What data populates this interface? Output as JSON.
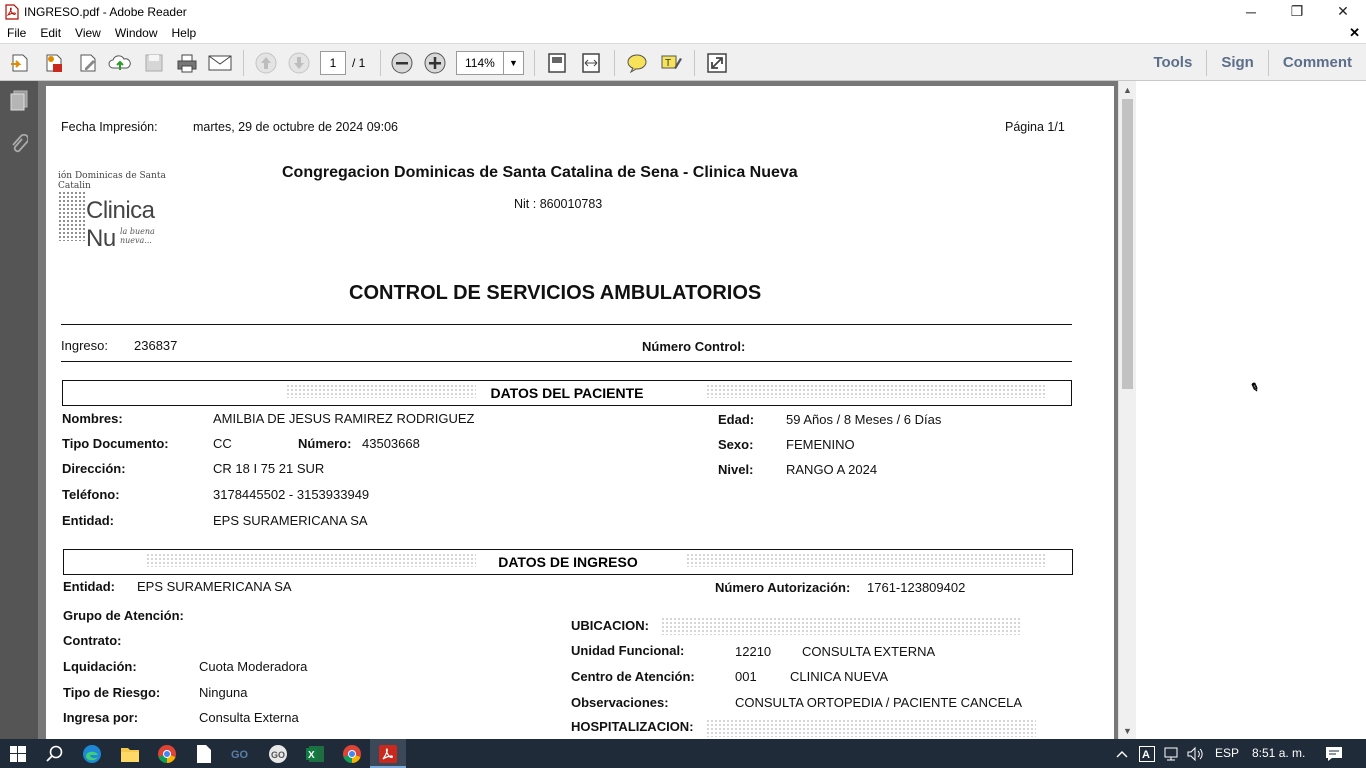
{
  "window": {
    "title": "INGRESO.pdf - Adobe Reader",
    "minimize_glyph": "─",
    "maximize_glyph": "❐",
    "close_glyph": "✕",
    "close_doc_glyph": "✕"
  },
  "menu": {
    "items": [
      "File",
      "Edit",
      "View",
      "Window",
      "Help"
    ]
  },
  "toolbar": {
    "page_current": "1",
    "page_total": "/ 1",
    "zoom": "114%",
    "right_links": [
      "Tools",
      "Sign",
      "Comment"
    ],
    "icons": [
      "open-icon",
      "create-pdf-icon",
      "edit-icon",
      "upload-cloud-icon",
      "save-icon",
      "print-icon",
      "email-icon",
      "prev-page-icon",
      "next-page-icon",
      "zoom-out-icon",
      "zoom-in-icon",
      "fit-page-icon",
      "fit-width-icon",
      "sticky-note-icon",
      "highlight-icon",
      "fullscreen-icon"
    ],
    "accent_color": "#5b6e8a"
  },
  "leftnav": {
    "icons": [
      "page-thumbnails-icon",
      "attachments-icon"
    ]
  },
  "document": {
    "print_date_label": "Fecha Impresión:",
    "print_date_value": "martes, 29 de octubre de 2024 09:06",
    "page_label": "Página 1/1",
    "org_name": "Congregacion Dominicas de Santa Catalina de Sena - Clinica Nueva",
    "nit": "Nit : 860010783",
    "logo": {
      "top": "ión Dominicas de Santa Catalin",
      "main": "Clinica Nu",
      "sub": "la buena nueva..."
    },
    "main_title": "CONTROL DE SERVICIOS AMBULATORIOS",
    "ingreso_label": "Ingreso:",
    "ingreso_value": "236837",
    "numero_control_label": "Número Control:",
    "patient_section": {
      "heading": "DATOS DEL PACIENTE",
      "nombres_label": "Nombres:",
      "nombres_value": "AMILBIA DE JESUS RAMIREZ RODRIGUEZ",
      "tipo_doc_label": "Tipo Documento:",
      "tipo_doc_value": "CC",
      "numero_label": "Número:",
      "numero_value": "43503668",
      "direccion_label": "Dirección:",
      "direccion_value": "CR 18 I 75 21 SUR",
      "telefono_label": "Teléfono:",
      "telefono_value": "3178445502 - 3153933949",
      "entidad_label": "Entidad:",
      "entidad_value": "EPS SURAMERICANA SA",
      "edad_label": "Edad:",
      "edad_value": "59 Años / 8 Meses / 6 Días",
      "sexo_label": "Sexo:",
      "sexo_value": "FEMENINO",
      "nivel_label": "Nivel:",
      "nivel_value": "RANGO A 2024"
    },
    "ingreso_section": {
      "heading": "DATOS DE INGRESO",
      "entidad_label": "Entidad:",
      "entidad_value": "EPS SURAMERICANA SA",
      "autorizacion_label": "Número Autorización:",
      "autorizacion_value": "1761-123809402",
      "grupo_label": "Grupo de Atención:",
      "contrato_label": "Contrato:",
      "liquidacion_label": "Lquidación:",
      "liquidacion_value": "Cuota Moderadora",
      "riesgo_label": "Tipo de Riesgo:",
      "riesgo_value": "Ninguna",
      "ingresa_label": "Ingresa por:",
      "ingresa_value": "Consulta Externa",
      "ubicacion_label": "UBICACION:",
      "unidad_label": "Unidad Funcional:",
      "unidad_code": "12210",
      "unidad_value": "CONSULTA EXTERNA",
      "centro_label": "Centro de Atención:",
      "centro_code": "001",
      "centro_value": "CLINICA NUEVA",
      "observaciones_label": "Observaciones:",
      "observaciones_value": "CONSULTA ORTOPEDIA / PACIENTE CANCELA",
      "hospitalizacion_label": "HOSPITALIZACION:"
    }
  },
  "taskbar": {
    "language": "ESP",
    "time": "8:51 a. m.",
    "apps": [
      "start-icon",
      "search-icon",
      "edge-icon",
      "file-explorer-icon",
      "chrome-icon",
      "blank-doc-icon",
      "go-app-icon",
      "go-chrome-icon",
      "excel-icon",
      "chrome-icon-2",
      "acrobat-icon"
    ]
  }
}
